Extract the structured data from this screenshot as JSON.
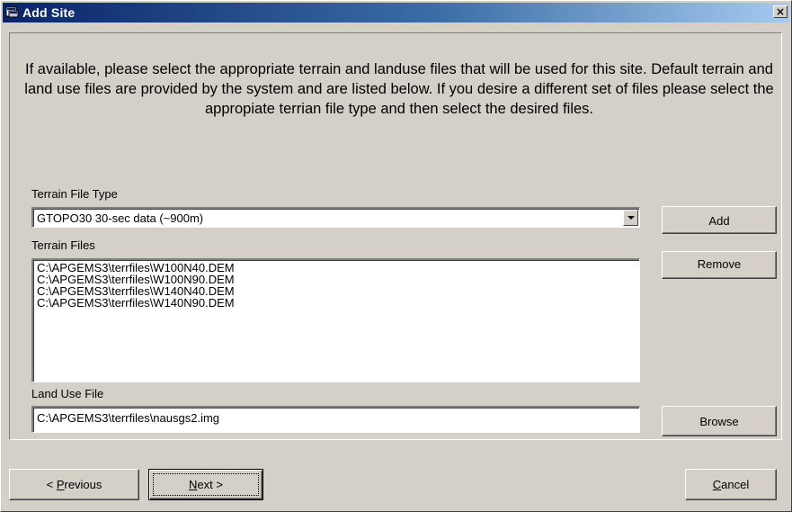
{
  "window": {
    "title": "Add Site",
    "close_glyph": "×"
  },
  "instructions": "If available, please select the appropriate terrain and landuse files that will be used for this site. Default terrain and land use files are provided by the system and are listed below. If you desire a different set of files please select the appropiate terrian file type and then select the desired files.",
  "terrain_type": {
    "label": "Terrain File Type",
    "selected": "GTOPO30 30-sec data (~900m)"
  },
  "terrain_files": {
    "label": "Terrain Files",
    "items": [
      "C:\\APGEMS3\\terrfiles\\W100N40.DEM",
      "C:\\APGEMS3\\terrfiles\\W100N90.DEM",
      "C:\\APGEMS3\\terrfiles\\W140N40.DEM",
      "C:\\APGEMS3\\terrfiles\\W140N90.DEM"
    ]
  },
  "land_use": {
    "label": "Land Use File",
    "value": "C:\\APGEMS3\\terrfiles\\nausgs2.img"
  },
  "buttons": {
    "add": "Add",
    "remove": "Remove",
    "browse": "Browse",
    "previous_prefix": "< ",
    "previous_mnemonic": "P",
    "previous_rest": "revious",
    "next_mnemonic": "N",
    "next_rest": "ext >",
    "cancel_mnemonic": "C",
    "cancel_rest": "ancel"
  },
  "icons": {
    "app": "dialog-app-icon",
    "close": "close-icon",
    "dropdown": "chevron-down-icon"
  }
}
